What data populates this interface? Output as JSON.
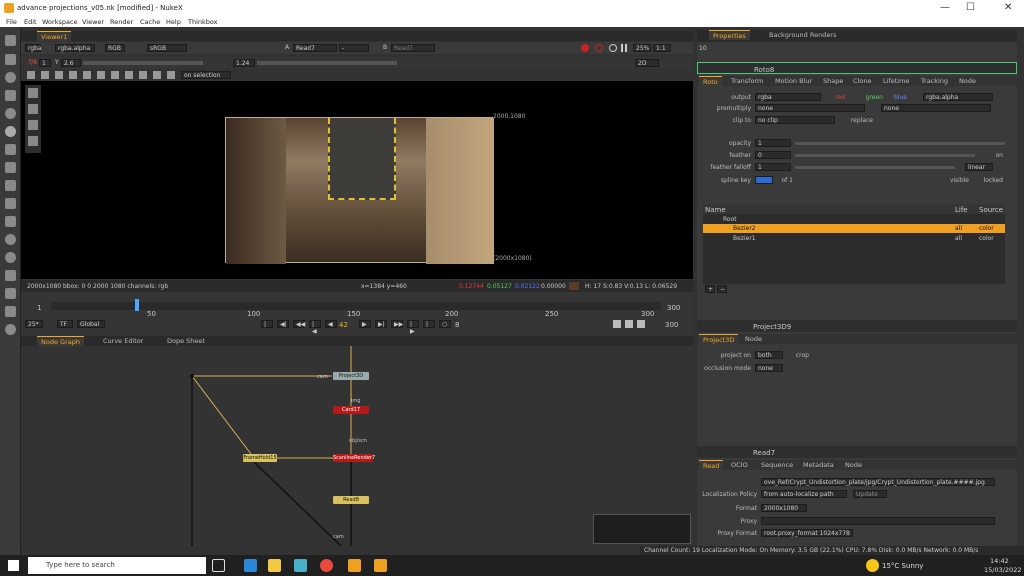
{
  "window": {
    "title": "advance projections_v05.nk [modified] - NukeX",
    "min": "—",
    "max": "☐",
    "close": "✕"
  },
  "menu": [
    "File",
    "Edit",
    "Workspace",
    "Viewer",
    "Render",
    "Cache",
    "Help",
    "Thinkbox"
  ],
  "viewer": {
    "tab": "Viewer1",
    "channels": "rgba",
    "alpha": "rgba.alpha",
    "rgb": "RGB",
    "colorspace": "sRGB",
    "inputA": "A",
    "inputA_node": "Read7",
    "dash": "-",
    "inputB": "B",
    "inputB_node": "Read7",
    "zoom": "25%",
    "ratio": "1:1",
    "gain_label": "f/8",
    "gain": "1",
    "gamma_label": "Y",
    "gamma": "2.6",
    "gamma_value": "1.24",
    "mode": "2D",
    "on_selection": "on selection",
    "format_corner_top": "2000,1080",
    "format_corner_bottom": "(2000x1080)",
    "info": "2000x1080  bbox: 0 0 2000 1080 channels: rgb",
    "coords": "x=1384 y=460",
    "r": "0.12744",
    "g": "0.05127",
    "b": "0.02122",
    "a": "0.00000",
    "hsv": "H: 17 S:0.83 V:0.13  L: 0.06529"
  },
  "timeline": {
    "fps": "25*",
    "tf": "TF",
    "global": "Global",
    "frame": "42",
    "step": "8",
    "frame_end": "300",
    "ticks": [
      "1",
      "50",
      "100",
      "150",
      "200",
      "250",
      "300"
    ],
    "end_top": "300"
  },
  "nodegraph": {
    "tabs": [
      "Node Graph",
      "Curve Editor",
      "Dope Sheet"
    ],
    "nodes": {
      "card17": "Card17",
      "scanline": "ScanlineRender7",
      "framehold": "FrameHold15",
      "project": "Project3D",
      "read": "Read8",
      "cam": "cam",
      "img": "img",
      "obj": "obj/scn",
      "cam2": "cam"
    }
  },
  "properties": {
    "tabs": [
      "Properties",
      "Background Renders"
    ],
    "count": "10",
    "roto": {
      "name": "Roto8",
      "tabs": [
        "Roto",
        "Transform",
        "Motion Blur",
        "Shape",
        "Clone",
        "Lifetime",
        "Tracking",
        "Node"
      ],
      "output_label": "output",
      "output": "rgba",
      "red": "red",
      "green": "green",
      "blue": "blue",
      "alpha": "rgba.alpha",
      "premult_label": "premultiply",
      "premult": "none",
      "premult2": "none",
      "clip_label": "clip to",
      "clip": "no clip",
      "replace": "replace",
      "opacity_label": "opacity",
      "opacity": "1",
      "feather_label": "feather",
      "feather": "0",
      "feather_on": "on",
      "falloff_label": "feather falloff",
      "falloff": "1",
      "falloff_mode": "linear",
      "spline_label": "spline key",
      "spline_of": "of 1",
      "visible": "visible",
      "locked": "locked",
      "list_headers": [
        "Name",
        "Life",
        "Source"
      ],
      "items": [
        {
          "name": "Root",
          "life": "",
          "source": ""
        },
        {
          "name": "Bezier2",
          "life": "all",
          "source": "color"
        },
        {
          "name": "Bezier1",
          "life": "all",
          "source": "color"
        }
      ]
    },
    "project3d": {
      "name": "Project3D9",
      "tabs": [
        "Project3D",
        "Node"
      ],
      "project_on_label": "project on",
      "project_on": "both",
      "crop": "crop",
      "occlusion_label": "occlusion mode",
      "occlusion": "none"
    },
    "read": {
      "name": "Read7",
      "tabs": [
        "Read",
        "OCIO",
        "Sequence",
        "Metadata",
        "Node"
      ],
      "file_label": "File",
      "file": "ove_Ref/Crypt_Undistortion_plate/jpg/Crypt_Undistortion_plate.####.jpg",
      "loc_label": "Localization Policy",
      "loc": "from auto-localize path",
      "update": "Update",
      "format_label": "Format",
      "format": "2000x1080",
      "proxy_label": "Proxy",
      "proxy_format_label": "Proxy Format",
      "proxy_format": "root.proxy_format 1024x778"
    }
  },
  "statusbar": "Channel Count: 19  Localization Mode: On  Memory: 3.5 GB (22.1%)  CPU: 7.8%  Disk: 0.0 MB/s  Network: 0.0 MB/s",
  "taskbar": {
    "search": "Type here to search",
    "weather": "15°C  Sunny",
    "time": "14:42",
    "date": "15/03/2022"
  },
  "colors": {
    "accent": "#f5a623",
    "node_red": "#b31a1a",
    "node_yellow": "#d7c25f"
  }
}
